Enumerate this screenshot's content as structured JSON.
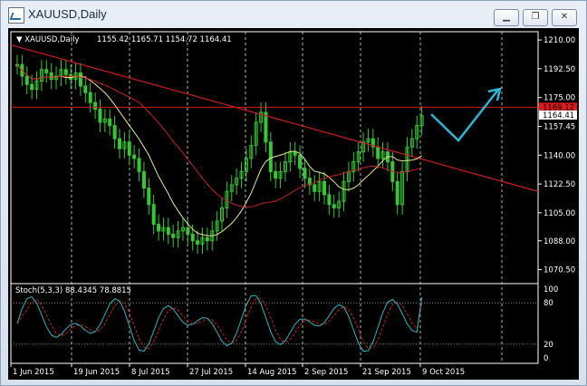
{
  "window": {
    "title": "XAUUSD,Daily",
    "minimize_icon": "minimize-icon",
    "restore_icon": "restore-icon",
    "close_icon": "close-icon"
  },
  "chart_header": {
    "symbol": "XAUUSD,Daily",
    "ohlc": "1155.42 1165.71 1154.72 1164.41"
  },
  "price_axis": {
    "ticks": [
      "1210.00",
      "1192.50",
      "1175.00",
      "1157.45",
      "1140.00",
      "1122.50",
      "1105.00",
      "1088.00",
      "1070.50"
    ],
    "tick_values": [
      1210.0,
      1192.5,
      1175.0,
      1157.45,
      1140.0,
      1122.5,
      1105.0,
      1088.0,
      1070.5
    ],
    "price_marker_red": "1169.12",
    "price_marker_current": "1164.41"
  },
  "date_axis": {
    "labels": [
      "1 Jun 2015",
      "19 Jun 2015",
      "8 Jul 2015",
      "27 Jul 2015",
      "14 Aug 2015",
      "2 Sep 2015",
      "21 Sep 2015",
      "9 Oct 2015"
    ]
  },
  "indicator": {
    "title": "Stoch(5,3,3) 88.4345 78.8815",
    "levels": [
      "100",
      "80",
      "20",
      "0"
    ]
  },
  "colors": {
    "bull_candle": "#34c832",
    "bear_candle": "#34c832",
    "ma_fast": "#e9e98a",
    "ma_slow": "#cc1f1f",
    "trendline": "#d01c1c",
    "horizontal_line": "#d01c1c",
    "projection": "#29b6d6",
    "stoch_main": "#29b6c8",
    "stoch_signal": "#d01c1c"
  }
}
